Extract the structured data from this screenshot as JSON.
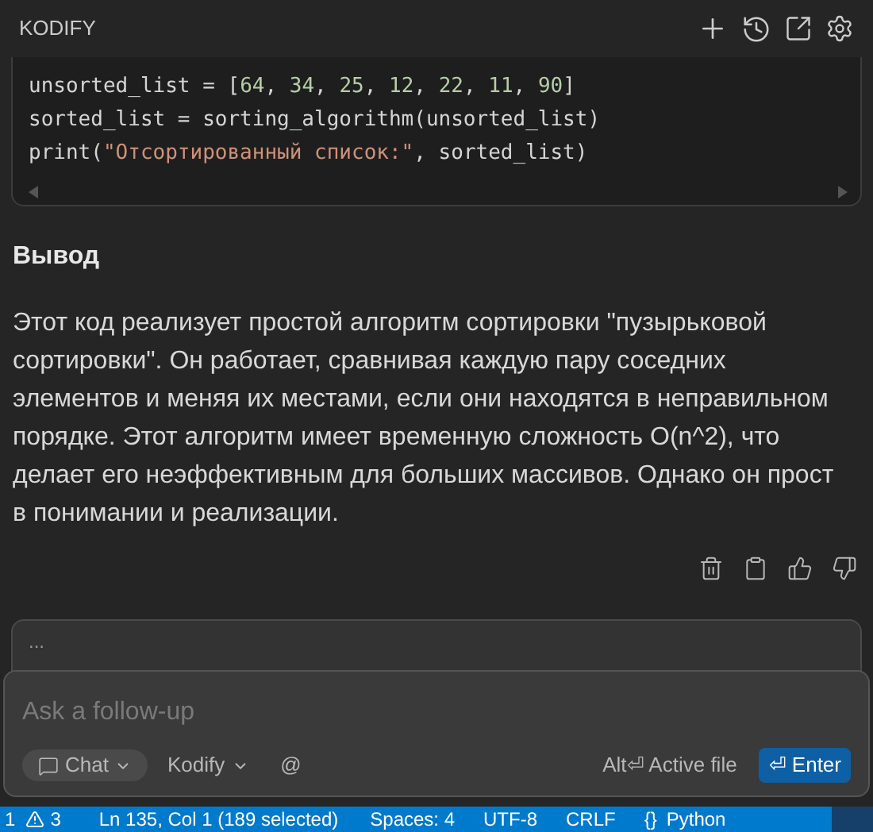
{
  "header": {
    "title": "KODIFY"
  },
  "code": {
    "lines": [
      [
        {
          "kind": "plain",
          "text": "unsorted_list = ["
        },
        {
          "kind": "number",
          "text": "64"
        },
        {
          "kind": "plain",
          "text": ", "
        },
        {
          "kind": "number",
          "text": "34"
        },
        {
          "kind": "plain",
          "text": ", "
        },
        {
          "kind": "number",
          "text": "25"
        },
        {
          "kind": "plain",
          "text": ", "
        },
        {
          "kind": "number",
          "text": "12"
        },
        {
          "kind": "plain",
          "text": ", "
        },
        {
          "kind": "number",
          "text": "22"
        },
        {
          "kind": "plain",
          "text": ", "
        },
        {
          "kind": "number",
          "text": "11"
        },
        {
          "kind": "plain",
          "text": ", "
        },
        {
          "kind": "number",
          "text": "90"
        },
        {
          "kind": "plain",
          "text": "]"
        }
      ],
      [
        {
          "kind": "plain",
          "text": "sorted_list = sorting_algorithm(unsorted_list)"
        }
      ],
      [
        {
          "kind": "plain",
          "text": "print("
        },
        {
          "kind": "string",
          "text": "\"Отсортированный список:\""
        },
        {
          "kind": "plain",
          "text": ", sorted_list)"
        }
      ]
    ]
  },
  "section": {
    "heading": "Вывод",
    "paragraph": "Этот код реализует простой алгоритм сортировки \"пузырьковой сортировки\". Он работает, сравнивая каждую пару соседних элементов и меняя их местами, если они находятся в неправильном порядке. Этот алгоритм имеет временную сложность O(n^2), что делает его неэффективным для больших массивов. Однако он прост в понимании и реализации."
  },
  "previous_input": {
    "text": "..."
  },
  "input": {
    "placeholder": "Ask a follow-up",
    "mode": "Chat",
    "model": "Kodify",
    "mention": "@",
    "hint": "Alt⏎ Active file",
    "submit": "⏎ Enter"
  },
  "status_bar": {
    "problems": "1",
    "warnings": "3",
    "position": "Ln 135, Col 1 (189 selected)",
    "spaces": "Spaces: 4",
    "encoding": "UTF-8",
    "eol": "CRLF",
    "language_icon": "{}",
    "language": "Python"
  }
}
